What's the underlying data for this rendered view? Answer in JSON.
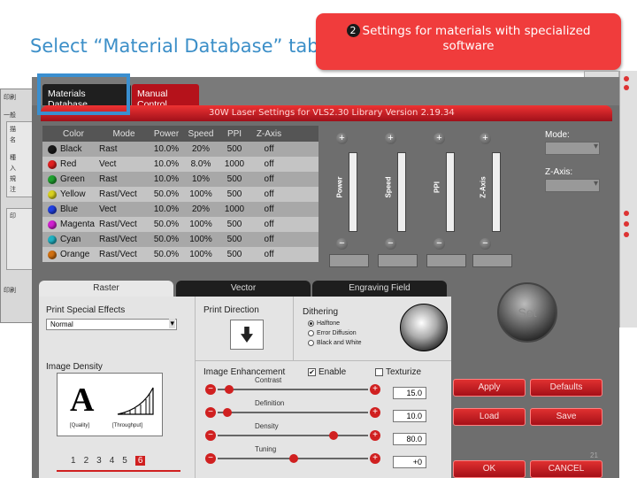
{
  "slide": {
    "title": "Select “Material Database” tab",
    "callout_number": "2",
    "callout_text": "Settings for materials with specialized software",
    "page_number": "21"
  },
  "background_window": {
    "labels": [
      "印刷",
      "一般",
      "描",
      "名",
      "種",
      "入",
      "規",
      "注",
      "印",
      "印刷"
    ]
  },
  "dialog": {
    "tabs": [
      {
        "label": "Materials Database",
        "active": true
      },
      {
        "label": "Manual Control",
        "active": false
      }
    ],
    "header": "30W Laser Settings for VLS2.30   Library Version 2.19.34",
    "colors": {
      "accent_red": "#b5121b",
      "highlight_blue": "#3a8fd0",
      "callout_red": "#f03c3c"
    }
  },
  "table": {
    "headers": [
      "Color",
      "Mode",
      "Power",
      "Speed",
      "PPI",
      "Z-Axis"
    ],
    "rows": [
      {
        "color": "Black",
        "swatch": "#1a1a1a",
        "mode": "Rast",
        "power": "10.0%",
        "speed": "20%",
        "ppi": "500",
        "z": "off"
      },
      {
        "color": "Red",
        "swatch": "#e02020",
        "mode": "Vect",
        "power": "10.0%",
        "speed": "8.0%",
        "ppi": "1000",
        "z": "off"
      },
      {
        "color": "Green",
        "swatch": "#20a030",
        "mode": "Rast",
        "power": "10.0%",
        "speed": "10%",
        "ppi": "500",
        "z": "off"
      },
      {
        "color": "Yellow",
        "swatch": "#d8d020",
        "mode": "Rast/Vect",
        "power": "50.0%",
        "speed": "100%",
        "ppi": "500",
        "z": "off"
      },
      {
        "color": "Blue",
        "swatch": "#2040e0",
        "mode": "Vect",
        "power": "10.0%",
        "speed": "20%",
        "ppi": "1000",
        "z": "off"
      },
      {
        "color": "Magenta",
        "swatch": "#d020d0",
        "mode": "Rast/Vect",
        "power": "50.0%",
        "speed": "100%",
        "ppi": "500",
        "z": "off"
      },
      {
        "color": "Cyan",
        "swatch": "#20b0c0",
        "mode": "Rast/Vect",
        "power": "50.0%",
        "speed": "100%",
        "ppi": "500",
        "z": "off"
      },
      {
        "color": "Orange",
        "swatch": "#d07010",
        "mode": "Rast/Vect",
        "power": "50.0%",
        "speed": "100%",
        "ppi": "500",
        "z": "off"
      }
    ]
  },
  "sliders": {
    "power_label": "Power",
    "speed_label": "Speed",
    "ppi_label": "PPI",
    "zaxis_label": "Z-Axis",
    "plus_glyph": "+",
    "minus_glyph": "−"
  },
  "side": {
    "mode_label": "Mode:",
    "zaxis_label": "Z-Axis:"
  },
  "lower_tabs": {
    "raster": "Raster",
    "vector": "Vector",
    "engraving": "Engraving Field"
  },
  "raster": {
    "print_special_effects_label": "Print Special Effects",
    "effects_value": "Normal",
    "print_direction_label": "Print Direction",
    "dithering_label": "Dithering",
    "dithering_options": [
      "Halftone",
      "Error Diffusion",
      "Black and White"
    ],
    "dithering_selected": "Halftone",
    "image_density_label": "Image Density",
    "density_quality": "[Quality]",
    "density_throughput": "[Throughput]",
    "density_glyph": "A",
    "density_numbers": [
      "1",
      "2",
      "3",
      "4",
      "5",
      "6"
    ],
    "density_selected": "6",
    "image_enhancement_label": "Image Enhancement",
    "enable_label": "Enable",
    "texturize_label": "Texturize",
    "enable_checked": true,
    "texturize_checked": false,
    "contrast_label": "Contrast",
    "contrast_value": "15.0",
    "definition_label": "Definition",
    "definition_value": "10.0",
    "density_label": "Density",
    "density_value": "80.0",
    "tuning_label": "Tuning",
    "tuning_value": "+0"
  },
  "buttons": {
    "set": "Set",
    "apply": "Apply",
    "defaults": "Defaults",
    "load": "Load",
    "save": "Save",
    "ok": "OK",
    "cancel": "CANCEL"
  }
}
